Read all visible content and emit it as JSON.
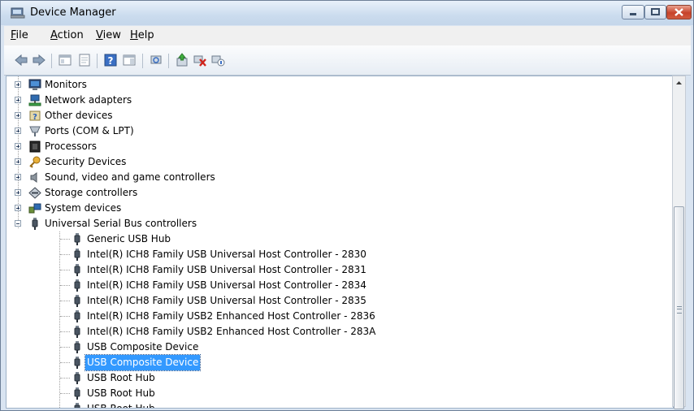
{
  "window": {
    "title": "Device Manager"
  },
  "menu": [
    {
      "accel": "F",
      "rest": "ile"
    },
    {
      "accel": "A",
      "rest": "ction"
    },
    {
      "accel": "V",
      "rest": "iew"
    },
    {
      "accel": "H",
      "rest": "elp"
    }
  ],
  "categories": [
    {
      "label": "Monitors",
      "icon": "monitor-icon",
      "expanded": false
    },
    {
      "label": "Network adapters",
      "icon": "network-icon",
      "expanded": false
    },
    {
      "label": "Other devices",
      "icon": "unknown-device-icon",
      "expanded": false
    },
    {
      "label": "Ports (COM & LPT)",
      "icon": "port-icon",
      "expanded": false
    },
    {
      "label": "Processors",
      "icon": "processor-icon",
      "expanded": false
    },
    {
      "label": "Security Devices",
      "icon": "security-key-icon",
      "expanded": false
    },
    {
      "label": "Sound, video and game controllers",
      "icon": "speaker-icon",
      "expanded": false
    },
    {
      "label": "Storage controllers",
      "icon": "storage-icon",
      "expanded": false
    },
    {
      "label": "System devices",
      "icon": "system-icon",
      "expanded": false
    },
    {
      "label": "Universal Serial Bus controllers",
      "icon": "usb-plug-icon",
      "expanded": true
    }
  ],
  "usb_devices": [
    {
      "label": "Generic USB Hub",
      "selected": false
    },
    {
      "label": "Intel(R) ICH8 Family USB Universal Host Controller - 2830",
      "selected": false
    },
    {
      "label": "Intel(R) ICH8 Family USB Universal Host Controller - 2831",
      "selected": false
    },
    {
      "label": "Intel(R) ICH8 Family USB Universal Host Controller - 2834",
      "selected": false
    },
    {
      "label": "Intel(R) ICH8 Family USB Universal Host Controller - 2835",
      "selected": false
    },
    {
      "label": "Intel(R) ICH8 Family USB2 Enhanced Host Controller - 2836",
      "selected": false
    },
    {
      "label": "Intel(R) ICH8 Family USB2 Enhanced Host Controller - 283A",
      "selected": false
    },
    {
      "label": "USB Composite Device",
      "selected": false
    },
    {
      "label": "USB Composite Device",
      "selected": true
    },
    {
      "label": "USB Root Hub",
      "selected": false
    },
    {
      "label": "USB Root Hub",
      "selected": false
    },
    {
      "label": "USB Root Hub",
      "selected": false
    }
  ],
  "colors": {
    "selection": "#3399ff",
    "title_gradient_top": "#e9f1fa",
    "close_button": "#c7432a"
  }
}
